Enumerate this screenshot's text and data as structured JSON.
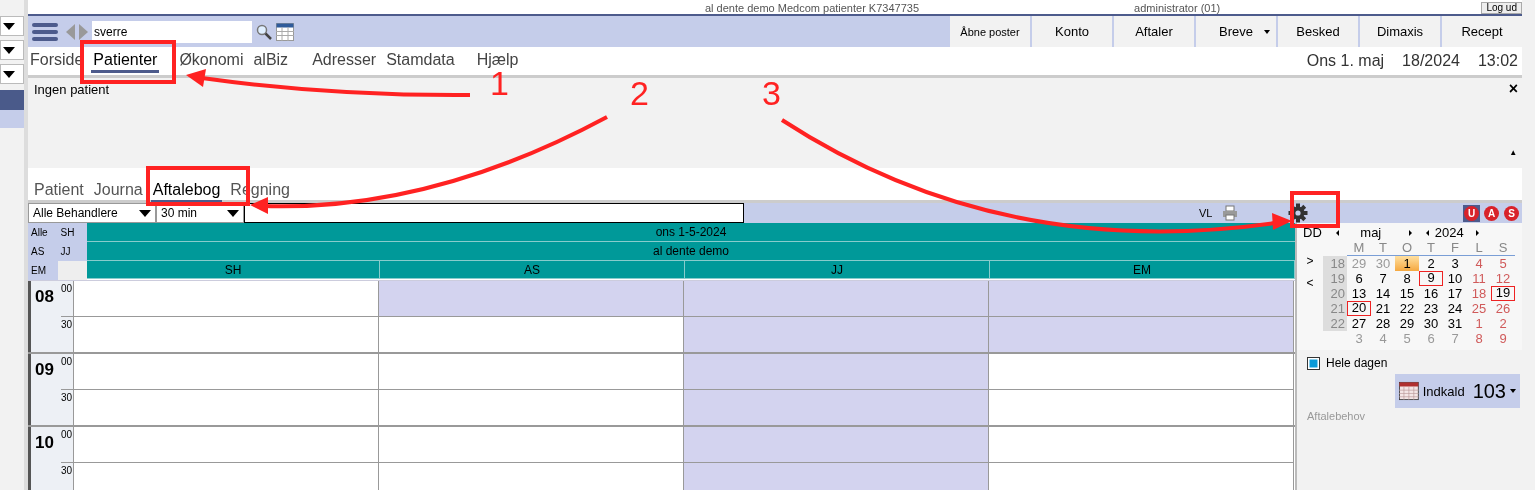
{
  "titlebar": {
    "title": "al dente demo Medcom patienter K7347735",
    "user": "administrator (01)",
    "logout": "Log ud"
  },
  "toolbar": {
    "search": {
      "value": "sverre"
    },
    "buttons": [
      {
        "label": "Åbne poster",
        "dropdown": false
      },
      {
        "label": "Konto",
        "dropdown": false
      },
      {
        "label": "Aftaler",
        "dropdown": false
      },
      {
        "label": "Breve",
        "dropdown": true
      },
      {
        "label": "Besked",
        "dropdown": false
      },
      {
        "label": "Dimaxis",
        "dropdown": false
      },
      {
        "label": "Recept",
        "dropdown": false
      }
    ]
  },
  "menu": [
    {
      "items": [
        {
          "label": "Forside",
          "selected": false
        },
        {
          "label": "Patienter",
          "selected": true
        },
        {
          "label": "Økonomi",
          "selected": false
        },
        {
          "label": "alBiz",
          "selected": false
        }
      ]
    },
    {
      "items": [
        {
          "label": "Adresser",
          "selected": false
        },
        {
          "label": "Stamdata",
          "selected": false
        },
        {
          "label": "Hjælp",
          "selected": false
        }
      ]
    }
  ],
  "clock": [
    "Ons 1. maj",
    "18/2024",
    "13:02"
  ],
  "patient_panel": {
    "text": "Ingen patient",
    "close": "×",
    "collapse": "▲"
  },
  "subtabs": [
    {
      "label": "Patient",
      "selected": false
    },
    {
      "label": "Journa",
      "selected": false
    },
    {
      "label": "Aftalebog",
      "selected": true
    },
    {
      "label": "Regning",
      "selected": false
    }
  ],
  "filter": {
    "practitioners": "Alle Behandlere",
    "interval": "30 min",
    "vl": "VL",
    "flags": [
      {
        "label": "U",
        "selected": true
      },
      {
        "label": "A",
        "selected": false
      },
      {
        "label": "S",
        "selected": false
      }
    ]
  },
  "groups": [
    [
      "Alle",
      "SH"
    ],
    [
      "AS",
      "JJ"
    ],
    [
      "EM"
    ]
  ],
  "schedule": {
    "date": "ons 1-5-2024",
    "clinic": "al dente demo",
    "columns": [
      "SH",
      "AS",
      "JJ",
      "EM"
    ],
    "hours": [
      {
        "label": "08",
        "slots": [
          {
            "minute": "00",
            "busy": [
              false,
              true,
              true,
              true
            ]
          },
          {
            "minute": "30",
            "busy": [
              false,
              false,
              true,
              true
            ]
          }
        ]
      },
      {
        "label": "09",
        "slots": [
          {
            "minute": "00",
            "busy": [
              false,
              false,
              true,
              false
            ]
          },
          {
            "minute": "30",
            "busy": [
              false,
              false,
              true,
              false
            ]
          }
        ]
      },
      {
        "label": "10",
        "slots": [
          {
            "minute": "00",
            "busy": [
              false,
              false,
              true,
              false
            ]
          },
          {
            "minute": "30",
            "busy": [
              false,
              false,
              true,
              false
            ]
          }
        ]
      }
    ]
  },
  "mini_calendar": {
    "mode": "DD",
    "month": "maj",
    "year": "2024",
    "next": ">",
    "prev": "<",
    "weekdays": [
      "M",
      "T",
      "O",
      "T",
      "F",
      "L",
      "S"
    ],
    "weeks": [
      {
        "week": "18",
        "days": [
          {
            "d": "29",
            "kind": "other"
          },
          {
            "d": "30",
            "kind": "other"
          },
          {
            "d": "1",
            "kind": "today"
          },
          {
            "d": "2",
            "kind": "normal"
          },
          {
            "d": "3",
            "kind": "normal"
          },
          {
            "d": "4",
            "kind": "closed"
          },
          {
            "d": "5",
            "kind": "closed"
          }
        ]
      },
      {
        "week": "19",
        "days": [
          {
            "d": "6",
            "kind": "normal"
          },
          {
            "d": "7",
            "kind": "normal"
          },
          {
            "d": "8",
            "kind": "normal"
          },
          {
            "d": "9",
            "kind": "marked"
          },
          {
            "d": "10",
            "kind": "normal"
          },
          {
            "d": "11",
            "kind": "closed"
          },
          {
            "d": "12",
            "kind": "closed"
          }
        ]
      },
      {
        "week": "20",
        "days": [
          {
            "d": "13",
            "kind": "normal"
          },
          {
            "d": "14",
            "kind": "normal"
          },
          {
            "d": "15",
            "kind": "normal"
          },
          {
            "d": "16",
            "kind": "normal"
          },
          {
            "d": "17",
            "kind": "normal"
          },
          {
            "d": "18",
            "kind": "closed"
          },
          {
            "d": "19",
            "kind": "marked"
          }
        ]
      },
      {
        "week": "21",
        "days": [
          {
            "d": "20",
            "kind": "marked"
          },
          {
            "d": "21",
            "kind": "normal"
          },
          {
            "d": "22",
            "kind": "normal"
          },
          {
            "d": "23",
            "kind": "normal"
          },
          {
            "d": "24",
            "kind": "normal"
          },
          {
            "d": "25",
            "kind": "closed"
          },
          {
            "d": "26",
            "kind": "closed"
          }
        ]
      },
      {
        "week": "22",
        "days": [
          {
            "d": "27",
            "kind": "normal"
          },
          {
            "d": "28",
            "kind": "normal"
          },
          {
            "d": "29",
            "kind": "normal"
          },
          {
            "d": "30",
            "kind": "normal"
          },
          {
            "d": "31",
            "kind": "normal"
          },
          {
            "d": "1",
            "kind": "closed"
          },
          {
            "d": "2",
            "kind": "closed"
          }
        ]
      },
      {
        "days": [
          {
            "d": "3",
            "kind": "other"
          },
          {
            "d": "4",
            "kind": "other"
          },
          {
            "d": "5",
            "kind": "other"
          },
          {
            "d": "6",
            "kind": "other"
          },
          {
            "d": "7",
            "kind": "other"
          },
          {
            "d": "8",
            "kind": "closed"
          },
          {
            "d": "9",
            "kind": "closed"
          }
        ]
      }
    ]
  },
  "all_day": {
    "label": "Hele dagen",
    "checked": true
  },
  "recall": {
    "label": "Indkald",
    "count": "103"
  },
  "needs_label": "Aftalebehov",
  "annotations": [
    {
      "label": "1"
    },
    {
      "label": "2"
    },
    {
      "label": "3"
    }
  ]
}
